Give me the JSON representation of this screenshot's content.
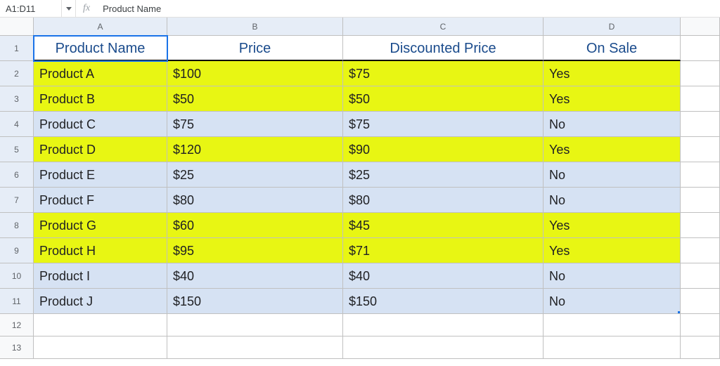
{
  "formula_bar": {
    "name_box": "A1:D11",
    "content": "Product Name"
  },
  "columns": [
    "A",
    "B",
    "C",
    "D",
    ""
  ],
  "headers": [
    "Product Name",
    "Price",
    "Discounted Price",
    "On Sale"
  ],
  "rows": [
    {
      "n": "1"
    },
    {
      "n": "2",
      "cells": [
        "Product A",
        "$100",
        "$75",
        "Yes"
      ],
      "hl": true
    },
    {
      "n": "3",
      "cells": [
        "Product B",
        "$50",
        "$50",
        "Yes"
      ],
      "hl": true
    },
    {
      "n": "4",
      "cells": [
        "Product C",
        "$75",
        "$75",
        "No"
      ],
      "hl": false
    },
    {
      "n": "5",
      "cells": [
        "Product D",
        "$120",
        "$90",
        "Yes"
      ],
      "hl": true
    },
    {
      "n": "6",
      "cells": [
        "Product E",
        "$25",
        "$25",
        "No"
      ],
      "hl": false
    },
    {
      "n": "7",
      "cells": [
        "Product F",
        "$80",
        "$80",
        "No"
      ],
      "hl": false
    },
    {
      "n": "8",
      "cells": [
        "Product G",
        "$60",
        "$45",
        "Yes"
      ],
      "hl": true
    },
    {
      "n": "9",
      "cells": [
        "Product H",
        "$95",
        "$71",
        "Yes"
      ],
      "hl": true
    },
    {
      "n": "10",
      "cells": [
        "Product I",
        "$40",
        "$40",
        "No"
      ],
      "hl": false
    },
    {
      "n": "11",
      "cells": [
        "Product J",
        "$150",
        "$150",
        "No"
      ],
      "hl": false
    }
  ],
  "empty_rows": [
    "12",
    "13"
  ]
}
